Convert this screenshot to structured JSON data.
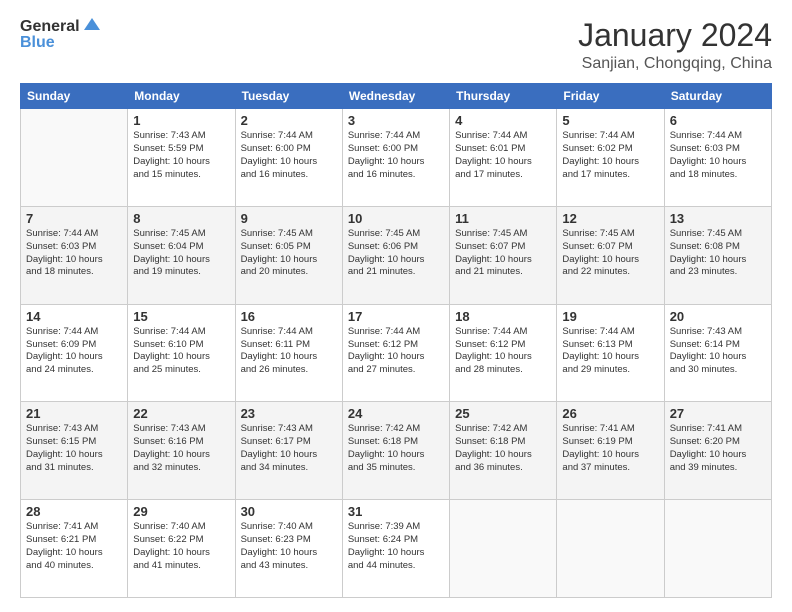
{
  "logo": {
    "line1": "General",
    "line2": "Blue"
  },
  "header": {
    "month": "January 2024",
    "location": "Sanjian, Chongqing, China"
  },
  "days_of_week": [
    "Sunday",
    "Monday",
    "Tuesday",
    "Wednesday",
    "Thursday",
    "Friday",
    "Saturday"
  ],
  "weeks": [
    [
      {
        "day": "",
        "info": ""
      },
      {
        "day": "1",
        "info": "Sunrise: 7:43 AM\nSunset: 5:59 PM\nDaylight: 10 hours\nand 15 minutes."
      },
      {
        "day": "2",
        "info": "Sunrise: 7:44 AM\nSunset: 6:00 PM\nDaylight: 10 hours\nand 16 minutes."
      },
      {
        "day": "3",
        "info": "Sunrise: 7:44 AM\nSunset: 6:00 PM\nDaylight: 10 hours\nand 16 minutes."
      },
      {
        "day": "4",
        "info": "Sunrise: 7:44 AM\nSunset: 6:01 PM\nDaylight: 10 hours\nand 17 minutes."
      },
      {
        "day": "5",
        "info": "Sunrise: 7:44 AM\nSunset: 6:02 PM\nDaylight: 10 hours\nand 17 minutes."
      },
      {
        "day": "6",
        "info": "Sunrise: 7:44 AM\nSunset: 6:03 PM\nDaylight: 10 hours\nand 18 minutes."
      }
    ],
    [
      {
        "day": "7",
        "info": "Sunrise: 7:44 AM\nSunset: 6:03 PM\nDaylight: 10 hours\nand 18 minutes."
      },
      {
        "day": "8",
        "info": "Sunrise: 7:45 AM\nSunset: 6:04 PM\nDaylight: 10 hours\nand 19 minutes."
      },
      {
        "day": "9",
        "info": "Sunrise: 7:45 AM\nSunset: 6:05 PM\nDaylight: 10 hours\nand 20 minutes."
      },
      {
        "day": "10",
        "info": "Sunrise: 7:45 AM\nSunset: 6:06 PM\nDaylight: 10 hours\nand 21 minutes."
      },
      {
        "day": "11",
        "info": "Sunrise: 7:45 AM\nSunset: 6:07 PM\nDaylight: 10 hours\nand 21 minutes."
      },
      {
        "day": "12",
        "info": "Sunrise: 7:45 AM\nSunset: 6:07 PM\nDaylight: 10 hours\nand 22 minutes."
      },
      {
        "day": "13",
        "info": "Sunrise: 7:45 AM\nSunset: 6:08 PM\nDaylight: 10 hours\nand 23 minutes."
      }
    ],
    [
      {
        "day": "14",
        "info": "Sunrise: 7:44 AM\nSunset: 6:09 PM\nDaylight: 10 hours\nand 24 minutes."
      },
      {
        "day": "15",
        "info": "Sunrise: 7:44 AM\nSunset: 6:10 PM\nDaylight: 10 hours\nand 25 minutes."
      },
      {
        "day": "16",
        "info": "Sunrise: 7:44 AM\nSunset: 6:11 PM\nDaylight: 10 hours\nand 26 minutes."
      },
      {
        "day": "17",
        "info": "Sunrise: 7:44 AM\nSunset: 6:12 PM\nDaylight: 10 hours\nand 27 minutes."
      },
      {
        "day": "18",
        "info": "Sunrise: 7:44 AM\nSunset: 6:12 PM\nDaylight: 10 hours\nand 28 minutes."
      },
      {
        "day": "19",
        "info": "Sunrise: 7:44 AM\nSunset: 6:13 PM\nDaylight: 10 hours\nand 29 minutes."
      },
      {
        "day": "20",
        "info": "Sunrise: 7:43 AM\nSunset: 6:14 PM\nDaylight: 10 hours\nand 30 minutes."
      }
    ],
    [
      {
        "day": "21",
        "info": "Sunrise: 7:43 AM\nSunset: 6:15 PM\nDaylight: 10 hours\nand 31 minutes."
      },
      {
        "day": "22",
        "info": "Sunrise: 7:43 AM\nSunset: 6:16 PM\nDaylight: 10 hours\nand 32 minutes."
      },
      {
        "day": "23",
        "info": "Sunrise: 7:43 AM\nSunset: 6:17 PM\nDaylight: 10 hours\nand 34 minutes."
      },
      {
        "day": "24",
        "info": "Sunrise: 7:42 AM\nSunset: 6:18 PM\nDaylight: 10 hours\nand 35 minutes."
      },
      {
        "day": "25",
        "info": "Sunrise: 7:42 AM\nSunset: 6:18 PM\nDaylight: 10 hours\nand 36 minutes."
      },
      {
        "day": "26",
        "info": "Sunrise: 7:41 AM\nSunset: 6:19 PM\nDaylight: 10 hours\nand 37 minutes."
      },
      {
        "day": "27",
        "info": "Sunrise: 7:41 AM\nSunset: 6:20 PM\nDaylight: 10 hours\nand 39 minutes."
      }
    ],
    [
      {
        "day": "28",
        "info": "Sunrise: 7:41 AM\nSunset: 6:21 PM\nDaylight: 10 hours\nand 40 minutes."
      },
      {
        "day": "29",
        "info": "Sunrise: 7:40 AM\nSunset: 6:22 PM\nDaylight: 10 hours\nand 41 minutes."
      },
      {
        "day": "30",
        "info": "Sunrise: 7:40 AM\nSunset: 6:23 PM\nDaylight: 10 hours\nand 43 minutes."
      },
      {
        "day": "31",
        "info": "Sunrise: 7:39 AM\nSunset: 6:24 PM\nDaylight: 10 hours\nand 44 minutes."
      },
      {
        "day": "",
        "info": ""
      },
      {
        "day": "",
        "info": ""
      },
      {
        "day": "",
        "info": ""
      }
    ]
  ]
}
